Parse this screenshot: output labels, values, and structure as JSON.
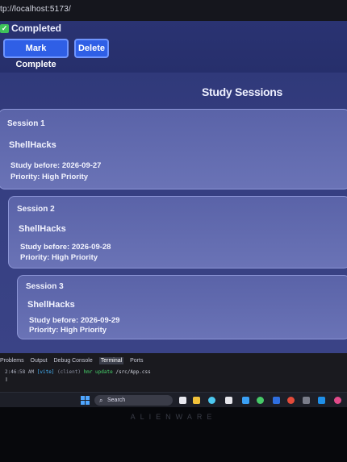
{
  "browser": {
    "address": "tp://localhost:5173/"
  },
  "task": {
    "status_label": "Completed",
    "mark_complete_label": "Mark Complete",
    "delete_label": "Delete"
  },
  "sessions": {
    "title": "Study Sessions",
    "items": [
      {
        "label": "Session 1",
        "name": "ShellHacks",
        "date": "Study before: 2026-09-27",
        "priority": "Priority: High Priority"
      },
      {
        "label": "Session 2",
        "name": "ShellHacks",
        "date": "Study before: 2026-09-28",
        "priority": "Priority: High Priority"
      },
      {
        "label": "Session 3",
        "name": "ShellHacks",
        "date": "Study before: 2026-09-29",
        "priority": "Priority: High Priority"
      }
    ]
  },
  "panel": {
    "tabs": [
      "Problems",
      "Output",
      "Debug Console",
      "Terminal",
      "Ports"
    ],
    "active_tab": "Terminal",
    "terminal": {
      "time": "2:46:58 AM",
      "vite": "[vite]",
      "client": "(client)",
      "hmr": "hmr update",
      "file": "/src/App.css",
      "cursor": "▯"
    }
  },
  "taskbar": {
    "search_label": "Search"
  },
  "device": {
    "brand": "ALIENWARE"
  },
  "colors": {
    "accent": "#2f5fe6",
    "card": "#6a73b6",
    "band": "#363f82"
  }
}
